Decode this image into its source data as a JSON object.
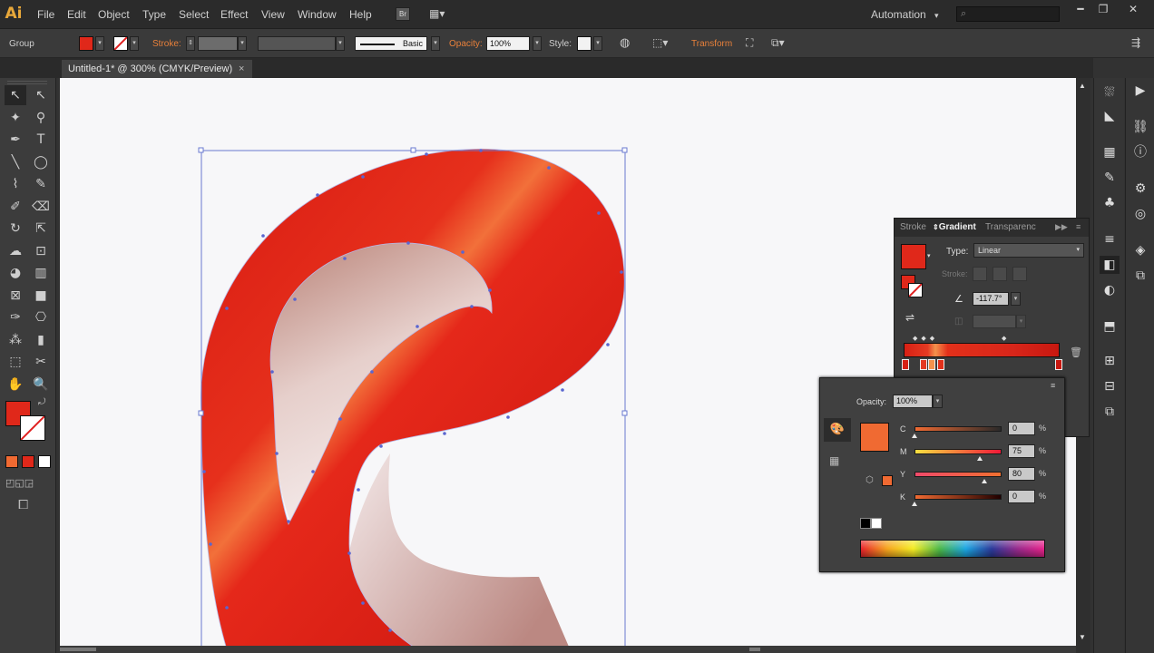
{
  "app": {
    "logo": "Ai"
  },
  "menu": [
    "File",
    "Edit",
    "Object",
    "Type",
    "Select",
    "Effect",
    "View",
    "Window",
    "Help"
  ],
  "menubar_right": {
    "workspace": "Automation",
    "workspace_arrow": "▾",
    "search_placeholder": ""
  },
  "window_buttons": {
    "minimize": "━",
    "restore": "❐",
    "close": "✕"
  },
  "control_bar": {
    "selection_label": "Group",
    "stroke_label": "Stroke:",
    "brush_label": "Basic",
    "opacity_label": "Opacity:",
    "opacity_value": "100%",
    "style_label": "Style:",
    "transform_label": "Transform"
  },
  "document_tab": {
    "title": "Untitled-1* @ 300% (CMYK/Preview)",
    "close": "×"
  },
  "gradient_panel": {
    "tabs": [
      "Stroke",
      "Gradient",
      "Transparency"
    ],
    "active_tab": "Gradient",
    "type_label": "Type:",
    "type_value": "Linear",
    "stroke_label": "Stroke:",
    "angle_value": "-117.7°",
    "colors": {
      "fill": "#e0281a"
    }
  },
  "color_panel": {
    "opacity_label": "Opacity:",
    "opacity_value": "100%",
    "fill_color": "#f06a32",
    "sliders": [
      {
        "label": "C",
        "value": "0",
        "unit": "%",
        "fraction": 0.0
      },
      {
        "label": "M",
        "value": "75",
        "unit": "%",
        "fraction": 0.75
      },
      {
        "label": "Y",
        "value": "80",
        "unit": "%",
        "fraction": 0.8
      },
      {
        "label": "K",
        "value": "0",
        "unit": "%",
        "fraction": 0.0
      }
    ]
  },
  "tool_icons": [
    "selection-icon",
    "direct-selection-icon",
    "magic-wand-icon",
    "lasso-icon",
    "pen-icon",
    "type-icon",
    "line-icon",
    "ellipse-icon",
    "paintbrush-icon",
    "pencil-icon",
    "blob-brush-icon",
    "eraser-icon",
    "rotate-icon",
    "scale-icon",
    "warp-icon",
    "free-transform-icon",
    "shape-builder-icon",
    "perspective-grid-icon",
    "mesh-icon",
    "gradient-tool-icon",
    "eyedropper-icon",
    "blend-icon",
    "symbol-sprayer-icon",
    "column-graph-icon",
    "artboard-icon",
    "slice-icon",
    "hand-icon",
    "zoom-icon"
  ]
}
